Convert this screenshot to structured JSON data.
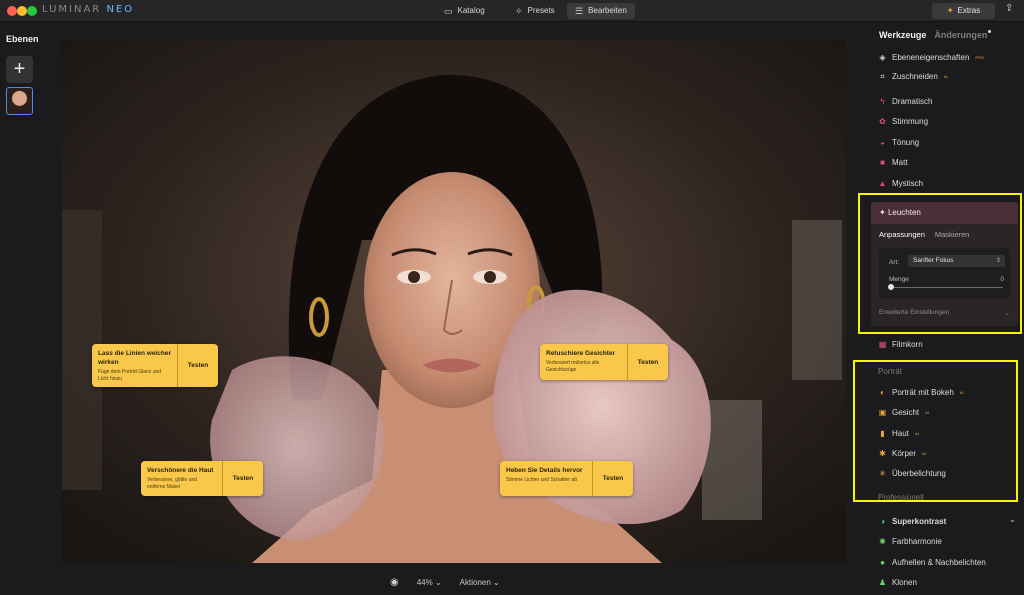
{
  "app": {
    "logo_text": "LUMINAR",
    "logo_accent": "NEO"
  },
  "topnav": {
    "katalog": "Katalog",
    "presets": "Presets",
    "bearbeiten": "Bearbeiten",
    "active": "bearbeiten",
    "extras": "Extras"
  },
  "layers": {
    "title": "Ebenen",
    "add_symbol": "+"
  },
  "hint_cards": [
    {
      "title": "Lass die Linien weicher wirken",
      "desc": "Füge dem Porträt Glanz und Licht hinzu",
      "button": "Testen"
    },
    {
      "title": "Retuschiere Gesichter",
      "desc": "Verbessert mühelos alle Gesichtszüge",
      "button": "Testen"
    },
    {
      "title": "Verschönere die Haut",
      "desc": "Verbessere, glätte und entferne Makel",
      "button": "Testen"
    },
    {
      "title": "Heben Sie Details hervor",
      "desc": "Stimme Lichter und Schatten ab",
      "button": "Testen"
    }
  ],
  "bottombar": {
    "zoom": "44% ⌄",
    "actions": "Aktionen ⌄"
  },
  "right_panel": {
    "tab_werkzeuge": "Werkzeuge",
    "tab_aenderungen": "Änderungen",
    "tools": [
      {
        "label": "Ebeneneigenschaften",
        "badge": "PRO",
        "icon": "layers-icon"
      },
      {
        "label": "Zuschneiden",
        "badge": "AI",
        "icon": "crop-icon"
      }
    ],
    "creative": [
      {
        "label": "Dramatisch",
        "icon": "lightning-icon"
      },
      {
        "label": "Stimmung",
        "icon": "mood-icon"
      },
      {
        "label": "Tönung",
        "icon": "toning-icon"
      },
      {
        "label": "Matt",
        "icon": "matte-icon"
      },
      {
        "label": "Mystisch",
        "icon": "mystic-icon"
      }
    ],
    "leuchten": {
      "title": "Leuchten",
      "subtab_on": "Anpassungen",
      "subtab_off": "Maskieren",
      "art_label": "Art:",
      "art_value": "Sanfter Fokus",
      "menge_label": "Menge",
      "menge_value": "0",
      "menge_level": 0,
      "advanced": "Erweiterte Einstellungen"
    },
    "filmkorn": "Filmkorn",
    "portrait_section": "Porträt",
    "portrait": [
      {
        "label": "Porträt mit Bokeh",
        "badge": "AI",
        "icon": "bokeh-icon"
      },
      {
        "label": "Gesicht",
        "badge": "AI",
        "icon": "face-icon"
      },
      {
        "label": "Haut",
        "badge": "AI",
        "icon": "skin-icon"
      },
      {
        "label": "Körper",
        "badge": "AI",
        "icon": "body-icon"
      },
      {
        "label": "Überbelichtung",
        "badge": "",
        "icon": "highkey-icon"
      }
    ],
    "professional_section": "Professionell",
    "professional": [
      {
        "label": "Superkontrast",
        "icon": "contrast-icon"
      },
      {
        "label": "Farbharmonie",
        "icon": "harmony-icon"
      },
      {
        "label": "Aufhellen & Nachbelichten",
        "icon": "dodge-icon"
      },
      {
        "label": "Klonen",
        "icon": "clone-icon"
      }
    ]
  },
  "colors": {
    "highlight": "#f5f500",
    "card": "#f9c84a",
    "accent": "#4a8cf0"
  }
}
